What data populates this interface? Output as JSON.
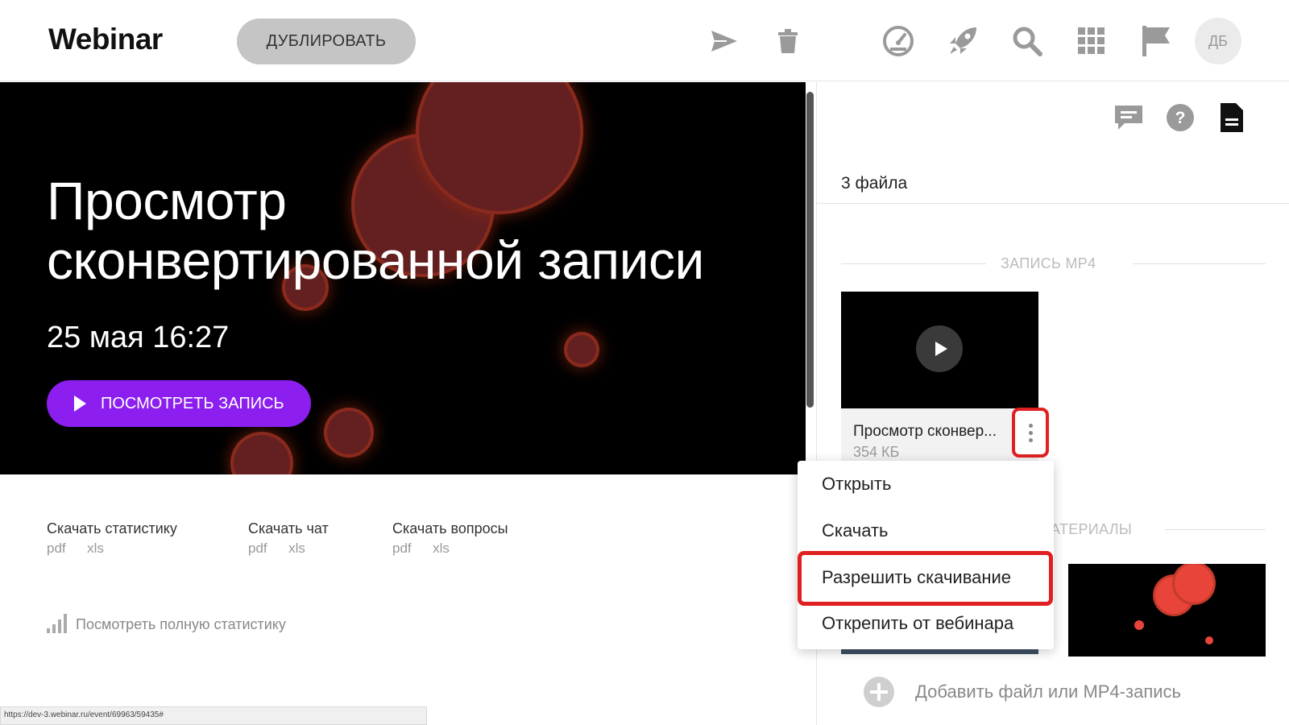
{
  "header": {
    "logo": "Webinar",
    "duplicate_label": "ДУБЛИРОВАТЬ",
    "avatar_initials": "ДБ"
  },
  "banner": {
    "title_line1": "Просмотр",
    "title_line2": "сконвертированной записи",
    "date": "25 мая 16:27",
    "watch_label": "ПОСМОТРЕТЬ ЗАПИСЬ"
  },
  "downloads": [
    {
      "title": "Скачать статистику",
      "formats": [
        "pdf",
        "xls"
      ]
    },
    {
      "title": "Скачать чат",
      "formats": [
        "pdf",
        "xls"
      ]
    },
    {
      "title": "Скачать вопросы",
      "formats": [
        "pdf",
        "xls"
      ]
    }
  ],
  "full_stats_label": "Посмотреть полную статистику",
  "status_url": "https://dev-3.webinar.ru/event/69963/59435#",
  "panel": {
    "files_count": "3 файла",
    "section_mp4": "ЗАПИСЬ MP4",
    "section_materials": "АТЕРИАЛЫ",
    "video_name": "Просмотр сконвер...",
    "video_size": "354 КБ",
    "add_file_label": "Добавить файл или MP4-запись"
  },
  "context_menu": {
    "items": [
      "Открыть",
      "Скачать",
      "Разрешить скачивание",
      "Открепить от вебинара"
    ]
  },
  "colors": {
    "accent_purple": "#8c1ff0",
    "highlight_red": "#e02020",
    "blob_red": "#642020"
  }
}
